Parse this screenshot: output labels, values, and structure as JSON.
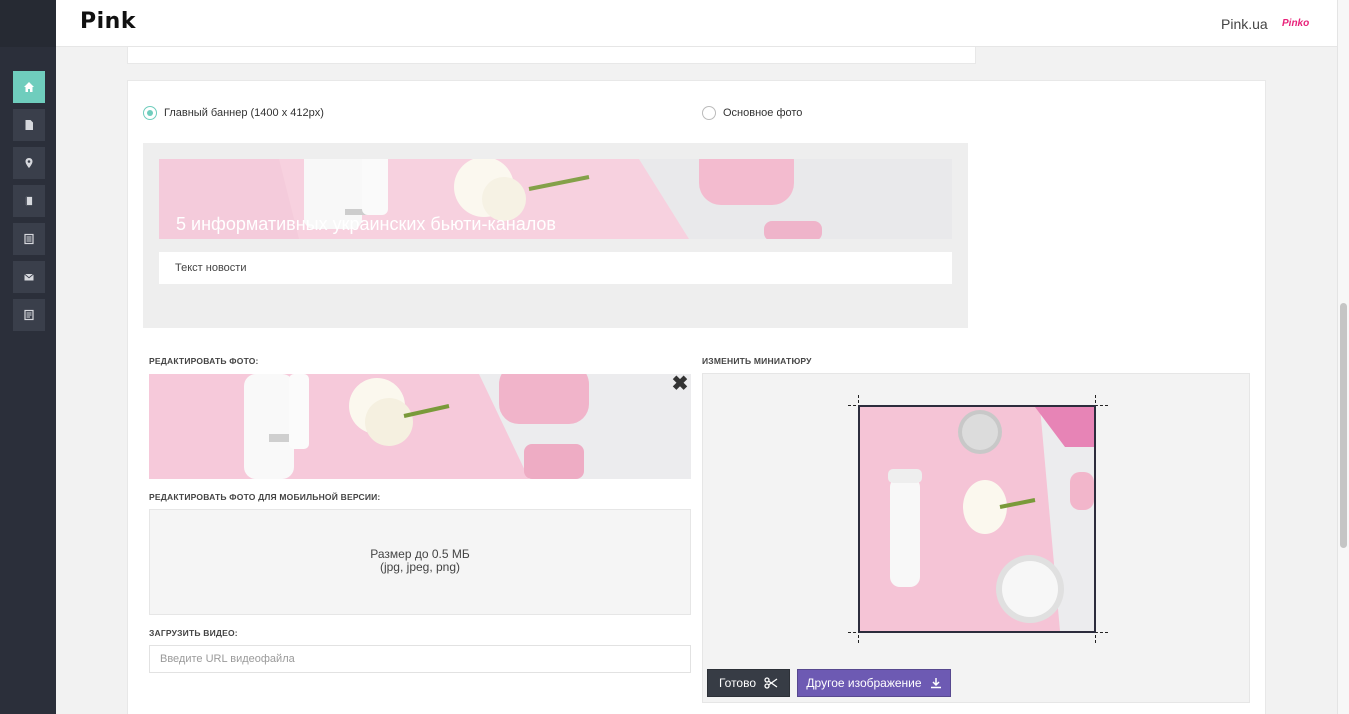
{
  "header": {
    "logo": "Pink",
    "site_link": "Pink.ua",
    "site_logo": "Pinko"
  },
  "sidebar": {
    "items": [
      {
        "icon": "home-icon",
        "active": true
      },
      {
        "icon": "document-icon",
        "active": false
      },
      {
        "icon": "location-pin-icon",
        "active": false
      },
      {
        "icon": "book-icon",
        "active": false
      },
      {
        "icon": "list-page-icon",
        "active": false
      },
      {
        "icon": "envelope-icon",
        "active": false
      },
      {
        "icon": "page-icon",
        "active": false
      }
    ]
  },
  "banner_type": {
    "option_main_banner": "Главный баннер (1400 x 412px)",
    "option_main_photo": "Основное фото",
    "selected": "main_banner"
  },
  "preview": {
    "banner_title": "5 информативных украинских бьюти-каналов",
    "news_text": "Текст новости"
  },
  "edit_photo": {
    "label": "Редактировать фото:"
  },
  "edit_mobile_photo": {
    "label": "Редактировать фото для мобильной версии:",
    "size_hint": "Размер до 0.5 МБ",
    "types_hint": "(jpg, jpeg, png)"
  },
  "video": {
    "label": "Загрузить видео:",
    "placeholder": "Введите URL видеофайла",
    "value": ""
  },
  "thumbnail": {
    "label": "Изменить миниатюру",
    "done_button": "Готово",
    "other_image_button": "Другое изображение"
  },
  "colors": {
    "accent": "#6fcdbd",
    "sidebar_bg": "#2b2f3a",
    "purple_button": "#6d5ab3",
    "dark_button": "#373c45",
    "brand_pink": "#e8227a"
  }
}
